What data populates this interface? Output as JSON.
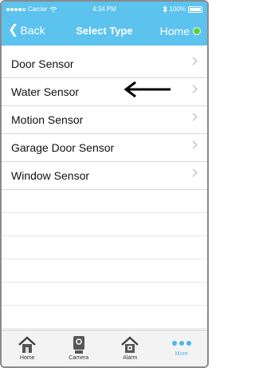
{
  "status_bar": {
    "carrier": "Carrier",
    "time": "4:34 PM",
    "battery": "100%"
  },
  "nav": {
    "back_label": "Back",
    "title": "Select Type",
    "home_label": "Home"
  },
  "list": {
    "items": [
      {
        "label": "Door Sensor"
      },
      {
        "label": "Water Sensor"
      },
      {
        "label": "Motion Sensor"
      },
      {
        "label": "Garage Door Sensor"
      },
      {
        "label": "Window Sensor"
      }
    ]
  },
  "tabbar": {
    "items": [
      {
        "label": "Home",
        "icon": "house-icon"
      },
      {
        "label": "Camera",
        "icon": "camera-icon"
      },
      {
        "label": "Alarm",
        "icon": "alarm-house-icon"
      },
      {
        "label": "More",
        "icon": "more-dots-icon"
      }
    ],
    "active": "More"
  },
  "colors": {
    "accent": "#5cc2ee",
    "status_online": "#5dd13a"
  }
}
